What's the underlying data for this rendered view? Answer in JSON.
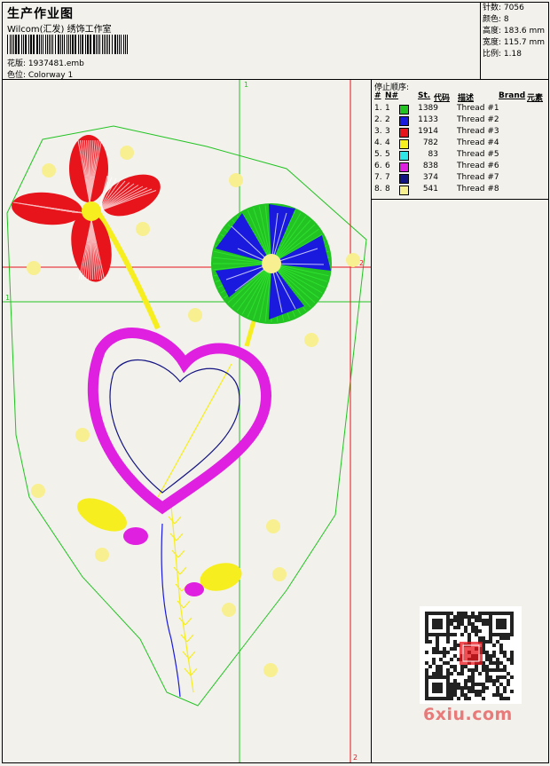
{
  "header": {
    "title": "生产作业图",
    "subtitle": "Wilcom(汇发) 绣饰工作室",
    "design_label": "花版: 1937481.emb",
    "colorway_label": "色位: Colorway 1"
  },
  "stats": {
    "stitches": "针数: 7056",
    "colors": "颜色: 8",
    "height": "高度: 183.6 mm",
    "width": "宽度: 115.7 mm",
    "scale": "比例: 1.18"
  },
  "stop_sequence": {
    "title": "停止顺序:",
    "headers": {
      "num": "#",
      "n": "N#",
      "st": "St.",
      "code": "代码",
      "desc": "描述",
      "brand": "Brand",
      "element": "元素"
    },
    "rows": [
      {
        "idx": "1.",
        "n": "1",
        "color": "#22c322",
        "st": "1389",
        "desc": "Thread #1"
      },
      {
        "idx": "2.",
        "n": "2",
        "color": "#1a1adf",
        "st": "1133",
        "desc": "Thread #2"
      },
      {
        "idx": "3.",
        "n": "3",
        "color": "#e8141c",
        "st": "1914",
        "desc": "Thread #3"
      },
      {
        "idx": "4.",
        "n": "4",
        "color": "#f6ee1e",
        "st": "782",
        "desc": "Thread #4"
      },
      {
        "idx": "5.",
        "n": "5",
        "color": "#2ee6e6",
        "st": "83",
        "desc": "Thread #5"
      },
      {
        "idx": "6.",
        "n": "6",
        "color": "#e020e0",
        "st": "838",
        "desc": "Thread #6"
      },
      {
        "idx": "7.",
        "n": "7",
        "color": "#141482",
        "st": "374",
        "desc": "Thread #7"
      },
      {
        "idx": "8.",
        "n": "8",
        "color": "#f8ef90",
        "st": "541",
        "desc": "Thread #8"
      }
    ]
  },
  "guides": {
    "v1": "1",
    "h1": "1",
    "h2": "2",
    "v2": "2"
  },
  "watermark": "6xiu.com"
}
